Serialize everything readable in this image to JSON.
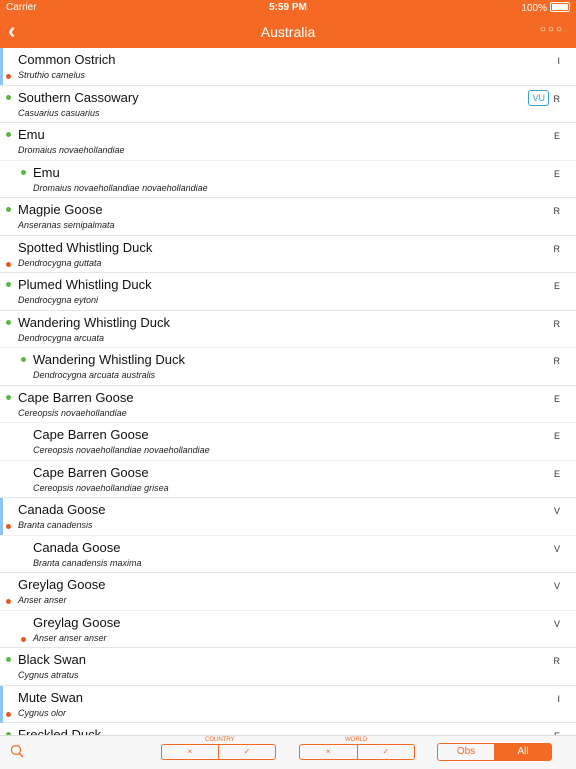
{
  "status_bar": {
    "carrier": "Carrier",
    "time": "5:59 PM",
    "battery": "100%"
  },
  "nav": {
    "back_icon": "chevron-left-icon",
    "title": "Australia",
    "more": "○○○"
  },
  "colors": {
    "accent": "#f46a24",
    "green": "#5cb544",
    "orange_dot": "#e35a20",
    "blue_bar": "#8cc6f0",
    "vu": "#37a2d6"
  },
  "species": [
    {
      "cn": "Common Ostrich",
      "sci": "Struthio camelus",
      "st": "I"
    },
    {
      "cn": "Southern Cassowary",
      "sci": "Casuarius casuarius",
      "st": "R",
      "badge": "VU"
    },
    {
      "cn": "Emu",
      "sci": "Dromaius novaehollandiae",
      "st": "E"
    },
    {
      "cn": "Emu",
      "sci": "Dromaius novaehollandiae novaehollandiae",
      "st": "E"
    },
    {
      "cn": "Magpie Goose",
      "sci": "Anseranas semipalmata",
      "st": "R"
    },
    {
      "cn": "Spotted Whistling Duck",
      "sci": "Dendrocygna guttata",
      "st": "R"
    },
    {
      "cn": "Plumed Whistling Duck",
      "sci": "Dendrocygna eytoni",
      "st": "E"
    },
    {
      "cn": "Wandering Whistling Duck",
      "sci": "Dendrocygna arcuata",
      "st": "R"
    },
    {
      "cn": "Wandering Whistling Duck",
      "sci": "Dendrocygna arcuata australis",
      "st": "R"
    },
    {
      "cn": "Cape Barren Goose",
      "sci": "Cereopsis novaehollandiae",
      "st": "E"
    },
    {
      "cn": "Cape Barren Goose",
      "sci": "Cereopsis novaehollandiae novaehollandiae",
      "st": "E"
    },
    {
      "cn": "Cape Barren Goose",
      "sci": "Cereopsis novaehollandiae grisea",
      "st": "E"
    },
    {
      "cn": "Canada Goose",
      "sci": "Branta canadensis",
      "st": "V"
    },
    {
      "cn": "Canada Goose",
      "sci": "Branta canadensis maxima",
      "st": "V"
    },
    {
      "cn": "Greylag Goose",
      "sci": "Anser anser",
      "st": "V"
    },
    {
      "cn": "Greylag Goose",
      "sci": "Anser anser anser",
      "st": "V"
    },
    {
      "cn": "Black Swan",
      "sci": "Cygnus atratus",
      "st": "R"
    },
    {
      "cn": "Mute Swan",
      "sci": "Cygnus olor",
      "st": "I"
    },
    {
      "cn": "Freckled Duck",
      "sci": "",
      "st": "E"
    }
  ],
  "toolbar": {
    "search_icon": "search-icon",
    "country_label": "COUNTRY",
    "world_label": "WORLD",
    "country_no": "×",
    "country_yes": "✓",
    "world_no": "×",
    "world_yes": "✓",
    "obs": "Obs",
    "all": "All"
  }
}
